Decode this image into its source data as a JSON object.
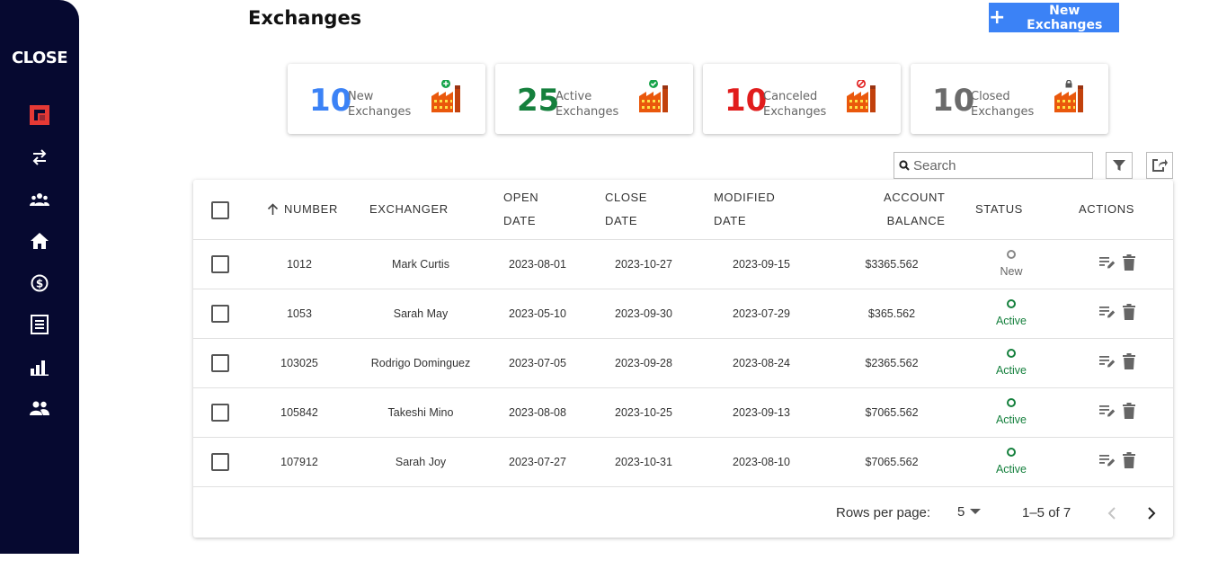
{
  "sidebar": {
    "brand": "CLOSE",
    "items": [
      {
        "icon": "logo-square-icon"
      },
      {
        "icon": "swap-arrows-icon"
      },
      {
        "icon": "group-icon"
      },
      {
        "icon": "home-icon"
      },
      {
        "icon": "dollar-circle-icon"
      },
      {
        "icon": "document-icon"
      },
      {
        "icon": "bar-chart-icon"
      },
      {
        "icon": "people-icon"
      }
    ]
  },
  "header": {
    "title": "Exchanges",
    "new_button_label": "New Exchanges"
  },
  "stats": [
    {
      "value": "10",
      "line1": "New",
      "line2": "Exchanges",
      "color": "#3b82f6",
      "badge": "plus"
    },
    {
      "value": "25",
      "line1": "Active",
      "line2": "Exchanges",
      "color": "#15803d",
      "badge": "check"
    },
    {
      "value": "10",
      "line1": "Canceled",
      "line2": "Exchanges",
      "color": "#e11d1d",
      "badge": "ban"
    },
    {
      "value": "10",
      "line1": "Closed",
      "line2": "Exchanges",
      "color": "#6b6b6b",
      "badge": "lock"
    }
  ],
  "toolbar": {
    "search_placeholder": "Search"
  },
  "table": {
    "columns": {
      "number": "NUMBER",
      "exchanger": "EXCHANGER",
      "open_date_1": "OPEN",
      "open_date_2": "DATE",
      "close_date_1": "CLOSE",
      "close_date_2": "DATE",
      "modified_date_1": "MODIFIED",
      "modified_date_2": "DATE",
      "balance_1": "ACCOUNT",
      "balance_2": "BALANCE",
      "status": "STATUS",
      "actions": "ACTIONS"
    },
    "rows": [
      {
        "number": "1012",
        "exchanger": "Mark Curtis",
        "open": "2023-08-01",
        "close": "2023-10-27",
        "modified": "2023-09-15",
        "balance": "$3365.562",
        "status": "New"
      },
      {
        "number": "1053",
        "exchanger": "Sarah May",
        "open": "2023-05-10",
        "close": "2023-09-30",
        "modified": "2023-07-29",
        "balance": "$365.562",
        "status": "Active"
      },
      {
        "number": "103025",
        "exchanger": "Rodrigo Dominguez",
        "open": "2023-07-05",
        "close": "2023-09-28",
        "modified": "2023-08-24",
        "balance": "$2365.562",
        "status": "Active"
      },
      {
        "number": "105842",
        "exchanger": "Takeshi Mino",
        "open": "2023-08-08",
        "close": "2023-10-25",
        "modified": "2023-09-13",
        "balance": "$7065.562",
        "status": "Active"
      },
      {
        "number": "107912",
        "exchanger": "Sarah Joy",
        "open": "2023-07-27",
        "close": "2023-10-31",
        "modified": "2023-08-10",
        "balance": "$7065.562",
        "status": "Active"
      }
    ],
    "status_colors": {
      "New": "#666666",
      "Active": "#15803d"
    }
  },
  "pagination": {
    "rows_per_page_label": "Rows per page:",
    "rows_per_page": "5",
    "range": "1–5 of 7"
  }
}
